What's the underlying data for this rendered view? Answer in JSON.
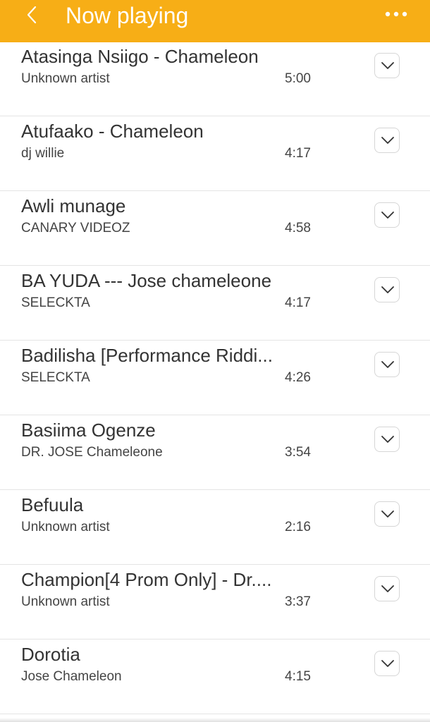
{
  "header": {
    "title": "Now playing",
    "background": "#f7ae16",
    "back_icon": "chevron-left-icon",
    "more_icon": "more-horizontal-icon"
  },
  "songs": [
    {
      "title": "Atasinga Nsiigo - Chameleon",
      "artist": "Unknown artist",
      "duration": "5:00"
    },
    {
      "title": "Atufaako - Chameleon",
      "artist": "dj willie",
      "duration": "4:17"
    },
    {
      "title": "Awli munage",
      "artist": "CANARY VIDEOZ",
      "duration": "4:58"
    },
    {
      "title": "BA YUDA --- Jose chameleone",
      "artist": "SELECKTA",
      "duration": "4:17"
    },
    {
      "title": "Badilisha [Performance Riddi...",
      "artist": "SELECKTA",
      "duration": "4:26"
    },
    {
      "title": "Basiima Ogenze",
      "artist": "DR. JOSE Chameleone",
      "duration": "3:54"
    },
    {
      "title": "Befuula",
      "artist": "Unknown artist",
      "duration": "2:16"
    },
    {
      "title": "Champion[4 Prom Only] - Dr....",
      "artist": "Unknown artist",
      "duration": "3:37"
    },
    {
      "title": "Dorotia",
      "artist": "Jose Chameleon",
      "duration": "4:15"
    }
  ]
}
